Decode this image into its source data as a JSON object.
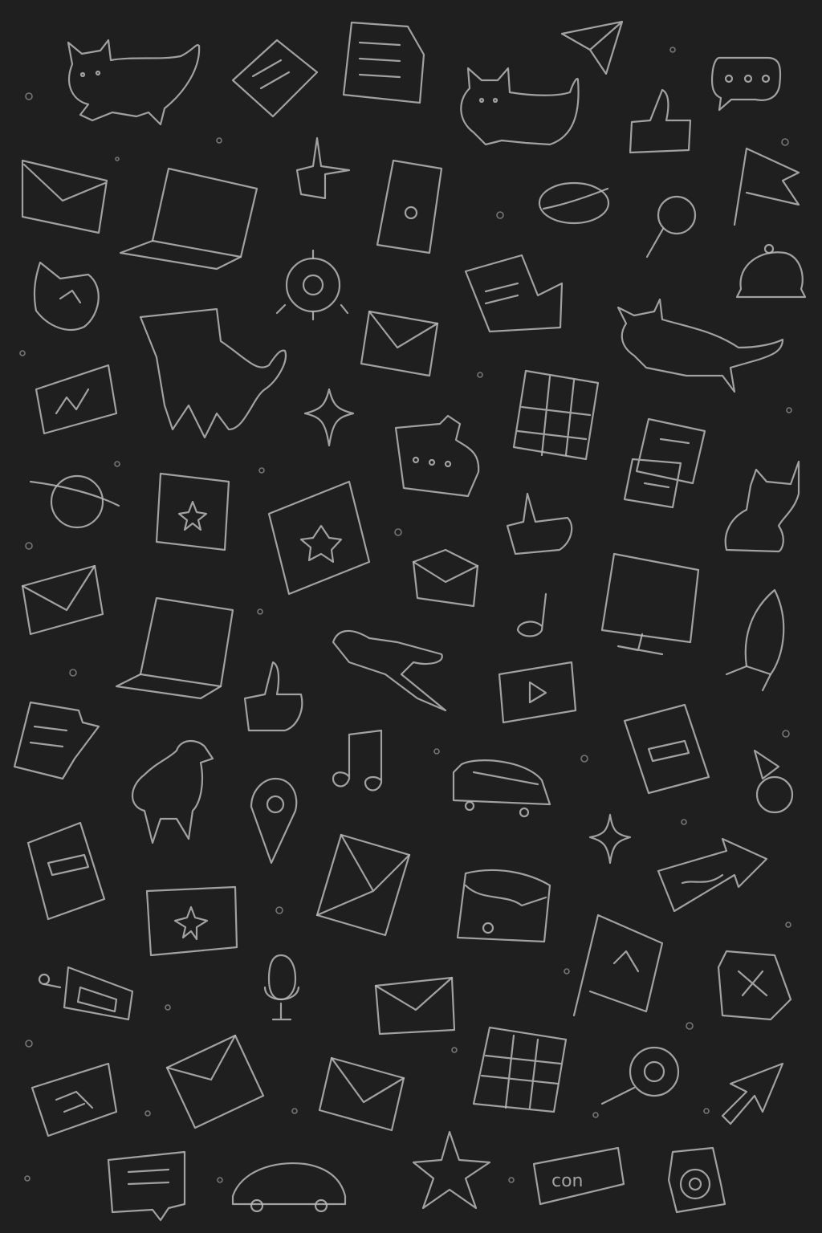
{
  "wallpaper": {
    "background_color": "#1f1f1f",
    "line_color": "#b9b9b9",
    "style": "hand-drawn line doodles"
  },
  "icons": [
    "cat-icon",
    "file-icon",
    "document-icon",
    "paper-plane-icon",
    "cat-icon",
    "chat-bubble-icon",
    "envelope-icon",
    "laptop-icon",
    "thumbs-up-icon",
    "phone-icon",
    "planet-icon",
    "magnifier-icon",
    "thumbs-up-icon",
    "flag-icon",
    "cat-icon",
    "camera-icon",
    "document-icon",
    "envelope-icon",
    "cat-icon",
    "bell-icon",
    "chart-icon",
    "tablet-icon",
    "sparkle-icon",
    "chat-icon",
    "calendar-icon",
    "document-icon",
    "planet-icon",
    "star-card-icon",
    "star-card-icon",
    "thumbs-up-icon",
    "cat-icon",
    "envelope-icon",
    "laptop-icon",
    "envelope-icon",
    "music-note-icon",
    "monitor-icon",
    "rocket-icon",
    "document-icon",
    "thumbs-up-icon",
    "airplane-icon",
    "play-video-icon",
    "bird-icon",
    "music-note-icon",
    "location-pin-icon",
    "bus-icon",
    "document-icon",
    "pin-icon",
    "document-icon",
    "envelope-icon",
    "sparkle-icon",
    "arrow-sign-icon",
    "picture-icon",
    "wallet-icon",
    "flag-icon",
    "phone-icon",
    "microphone-icon",
    "envelope-icon",
    "x-box-icon",
    "photo-icon",
    "envelope-icon",
    "envelope-icon",
    "calendar-icon",
    "search-icon",
    "arrow-icon",
    "chat-icon",
    "car-icon",
    "star-icon",
    "tag-icon",
    "at-sign-icon"
  ],
  "tag_text": "con"
}
